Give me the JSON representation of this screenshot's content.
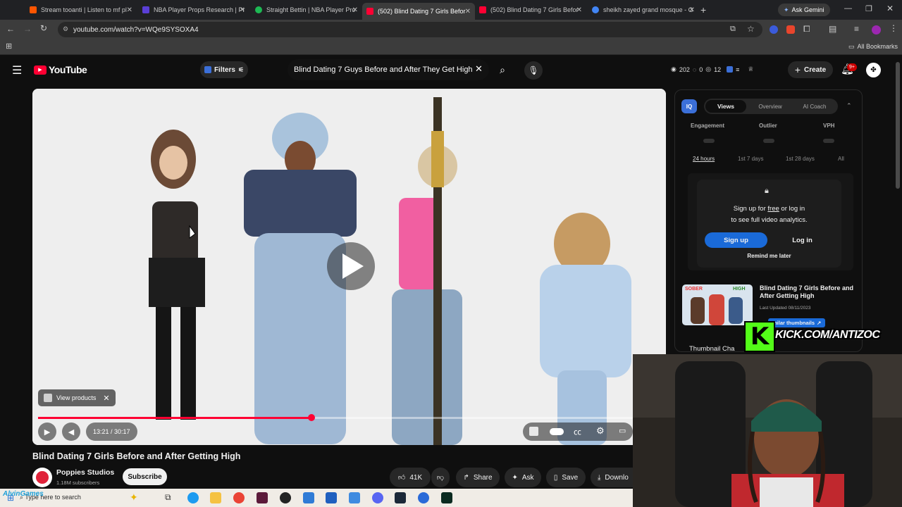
{
  "browser": {
    "tabs": [
      {
        "label": "Stream tooanti | Listen to mf pl",
        "color": "#ff5500"
      },
      {
        "label": "NBA Player Props Research | Pr",
        "color": "#5a3fd6"
      },
      {
        "label": "Straight Bettin | NBA Player Pro",
        "color": "#1db954"
      },
      {
        "label": "(502) Blind Dating 7 Girls Befor",
        "color": "#ff0033"
      },
      {
        "label": "(502) Blind Dating 7 Girls Befor",
        "color": "#ff0033"
      },
      {
        "label": "sheikh zayed grand mosque - G",
        "color": "#4285f4"
      }
    ],
    "ask_gemini": "Ask Gemini",
    "url": "youtube.com/watch?v=WQe9SYSOXA4",
    "all_bookmarks": "All Bookmarks"
  },
  "yt_header": {
    "logo": "YouTube",
    "filters": "Filters",
    "search_value": "Blind Dating 7 Guys Before and After They Get High",
    "stat_views": "202",
    "stat_zero": "0",
    "stat_twelve": "12",
    "create": "Create",
    "notif_badge": "9+"
  },
  "player": {
    "view_products": "View products",
    "time": "13:21 / 30:17",
    "progress": 0.46
  },
  "video_info": {
    "title": "Blind Dating 7 Girls Before and After Getting High",
    "channel": "Poppies Studios",
    "subscribers": "1.18M subscribers",
    "subscribe": "Subscribe",
    "likes": "41K",
    "share": "Share",
    "ask": "Ask",
    "save": "Save",
    "download": "Downlo"
  },
  "panel": {
    "badge": "IQ",
    "tabs": [
      "Views",
      "Overview",
      "AI Coach"
    ],
    "metrics": [
      "Engagement",
      "Outlier",
      "VPH"
    ],
    "ranges": [
      "24 hours",
      "1st 7 days",
      "1st 28 days",
      "All"
    ],
    "lock_line1_pre": "Sign up for ",
    "lock_free": "free",
    "lock_line1_post": " or log in",
    "lock_line2": "to see full video analytics.",
    "signup": "Sign up",
    "login": "Log in",
    "remind": "Remind me later",
    "related_title": "Blind Dating 7 Girls Before and After Getting High",
    "related_updated": "Last Updated 08/11/2023",
    "similar": "milar thumbnails",
    "thumb_label": "Thumbnail Cha"
  },
  "overlay": {
    "kick": "KICK.COM/ANTIZOC"
  },
  "taskbar": {
    "search": "Type here to search",
    "user": "AlvinGames"
  }
}
